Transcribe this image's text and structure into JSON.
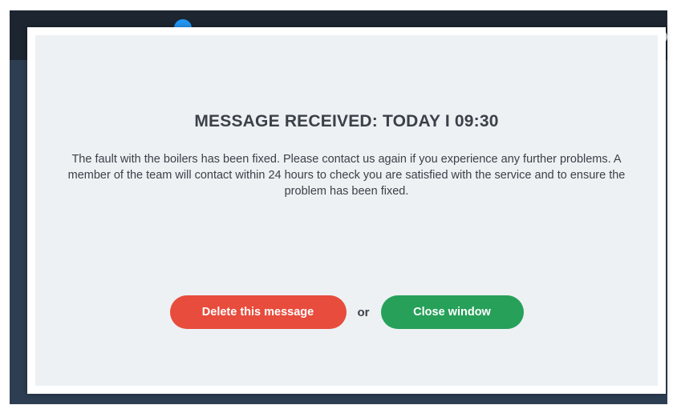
{
  "modal": {
    "title": "MESSAGE RECEIVED: TODAY I 09:30",
    "body": "The fault with the boilers has been fixed. Please contact us again if you experience any further problems. A member of the team will contact within 24 hours to check you are satisfied with the service and to ensure the problem has been fixed.",
    "delete_label": "Delete this message",
    "or_label": "or",
    "close_label": "Close window"
  },
  "colors": {
    "top_bar": "#1c2530",
    "backdrop": "#2d3e52",
    "modal_bg": "#edf1f4",
    "delete_button": "#e74c3c",
    "close_button": "#27a05a",
    "badge": "#2196f3",
    "text": "#3b4148"
  },
  "icons": {
    "top_bar_badge": "notification-badge-icon"
  }
}
